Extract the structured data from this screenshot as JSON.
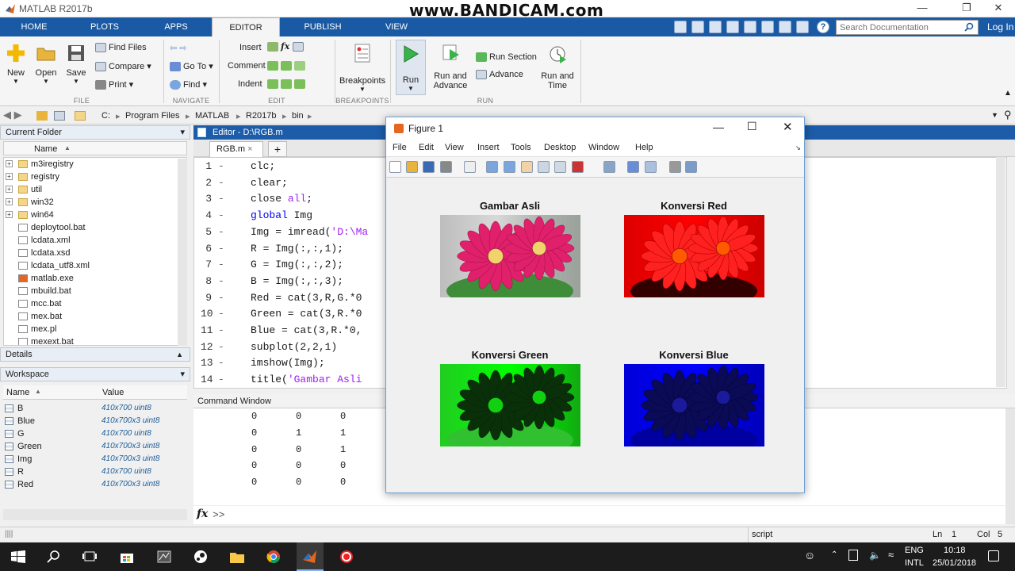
{
  "window": {
    "title": "MATLAB R2017b",
    "watermark": "www.BANDICAM.com"
  },
  "tabs": [
    {
      "label": "HOME"
    },
    {
      "label": "PLOTS"
    },
    {
      "label": "APPS"
    },
    {
      "label": "EDITOR",
      "active": true
    },
    {
      "label": "PUBLISH"
    },
    {
      "label": "VIEW"
    }
  ],
  "search": {
    "placeholder": "Search Documentation"
  },
  "login": "Log In",
  "ribbon": {
    "file": {
      "label": "FILE",
      "new": "New",
      "open": "Open",
      "save": "Save",
      "find_files": "Find Files",
      "compare": "Compare",
      "print": "Print"
    },
    "navigate": {
      "label": "NAVIGATE",
      "goto": "Go To",
      "find": "Find"
    },
    "edit": {
      "label": "EDIT",
      "insert": "Insert",
      "comment": "Comment",
      "indent": "Indent",
      "fx": "fx"
    },
    "breakpoints": {
      "label": "BREAKPOINTS",
      "btn": "Breakpoints"
    },
    "run": {
      "label": "RUN",
      "run": "Run",
      "run_advance_1": "Run and",
      "run_advance_2": "Advance",
      "run_section": "Run Section",
      "advance": "Advance",
      "run_time_1": "Run and",
      "run_time_2": "Time"
    }
  },
  "address": [
    "C:",
    "Program Files",
    "MATLAB",
    "R2017b",
    "bin"
  ],
  "current_folder": {
    "title": "Current Folder",
    "column": "Name",
    "items": [
      {
        "name": "m3iregistry",
        "type": "folder"
      },
      {
        "name": "registry",
        "type": "folder"
      },
      {
        "name": "util",
        "type": "folder"
      },
      {
        "name": "win32",
        "type": "folder"
      },
      {
        "name": "win64",
        "type": "folder"
      },
      {
        "name": "deploytool.bat",
        "type": "file"
      },
      {
        "name": "lcdata.xml",
        "type": "file"
      },
      {
        "name": "lcdata.xsd",
        "type": "file"
      },
      {
        "name": "lcdata_utf8.xml",
        "type": "file"
      },
      {
        "name": "matlab.exe",
        "type": "exe"
      },
      {
        "name": "mbuild.bat",
        "type": "file"
      },
      {
        "name": "mcc.bat",
        "type": "file"
      },
      {
        "name": "mex.bat",
        "type": "file"
      },
      {
        "name": "mex.pl",
        "type": "file"
      },
      {
        "name": "mexext.bat",
        "type": "file"
      }
    ]
  },
  "details": {
    "title": "Details"
  },
  "workspace": {
    "title": "Workspace",
    "col_name": "Name",
    "col_value": "Value",
    "vars": [
      {
        "name": "B",
        "value": "410x700 uint8"
      },
      {
        "name": "Blue",
        "value": "410x700x3 uint8"
      },
      {
        "name": "G",
        "value": "410x700 uint8"
      },
      {
        "name": "Green",
        "value": "410x700x3 uint8"
      },
      {
        "name": "Img",
        "value": "410x700x3 uint8"
      },
      {
        "name": "R",
        "value": "410x700 uint8"
      },
      {
        "name": "Red",
        "value": "410x700x3 uint8"
      }
    ]
  },
  "editor": {
    "title": "Editor - D:\\RGB.m",
    "tab": "RGB.m",
    "add_tab": "+",
    "lines": [
      {
        "n": "1",
        "parts": [
          [
            "",
            "clc;"
          ]
        ]
      },
      {
        "n": "2",
        "parts": [
          [
            "",
            "clear;"
          ]
        ]
      },
      {
        "n": "3",
        "parts": [
          [
            "",
            "close "
          ],
          [
            "str",
            "all"
          ],
          [
            "",
            ";"
          ]
        ]
      },
      {
        "n": "4",
        "parts": [
          [
            "kw",
            "global "
          ],
          [
            "",
            "Img"
          ]
        ]
      },
      {
        "n": "5",
        "parts": [
          [
            "",
            "Img = imread("
          ],
          [
            "str",
            "'D:\\Ma"
          ]
        ]
      },
      {
        "n": "6",
        "parts": [
          [
            "",
            "R = Img(:,:,1);"
          ]
        ]
      },
      {
        "n": "7",
        "parts": [
          [
            "",
            "G = Img(:,:,2);"
          ]
        ]
      },
      {
        "n": "8",
        "parts": [
          [
            "",
            "B = Img(:,:,3);"
          ]
        ]
      },
      {
        "n": "9",
        "parts": [
          [
            "",
            "Red = cat(3,R,G.*0"
          ]
        ]
      },
      {
        "n": "10",
        "parts": [
          [
            "",
            "Green = cat(3,R.*0"
          ]
        ]
      },
      {
        "n": "11",
        "parts": [
          [
            "",
            "Blue = cat(3,R.*0,"
          ]
        ]
      },
      {
        "n": "12",
        "parts": [
          [
            "",
            "subplot(2,2,1)"
          ]
        ]
      },
      {
        "n": "13",
        "parts": [
          [
            "",
            "imshow(Img);"
          ]
        ]
      },
      {
        "n": "14",
        "parts": [
          [
            "",
            "title("
          ],
          [
            "str",
            "'Gambar Asli"
          ]
        ]
      }
    ]
  },
  "command_window": {
    "title": "Command Window",
    "rows": [
      [
        "0",
        "0",
        "0"
      ],
      [
        "0",
        "1",
        "1"
      ],
      [
        "0",
        "0",
        "1"
      ],
      [
        "0",
        "0",
        "0"
      ],
      [
        "0",
        "0",
        "0"
      ]
    ],
    "prompt": ">>",
    "fx": "fx"
  },
  "figure": {
    "title": "Figure 1",
    "menu": [
      "File",
      "Edit",
      "View",
      "Insert",
      "Tools",
      "Desktop",
      "Window",
      "Help"
    ],
    "subplots": [
      {
        "title": "Gambar Asli",
        "tint": "original"
      },
      {
        "title": "Konversi Red",
        "tint": "red"
      },
      {
        "title": "Konversi Green",
        "tint": "green"
      },
      {
        "title": "Konversi Blue",
        "tint": "blue"
      }
    ]
  },
  "status": {
    "mode": "script",
    "ln_label": "Ln",
    "ln": "1",
    "col_label": "Col",
    "col": "5"
  },
  "taskbar": {
    "lang": "ENG",
    "lang2": "INTL",
    "time": "10:18",
    "date": "25/01/2018"
  },
  "colors": {
    "tabbar": "#1a5aa4",
    "editor_title": "#1c5ca8",
    "keyword": "#0000ff",
    "string": "#a020f0"
  }
}
